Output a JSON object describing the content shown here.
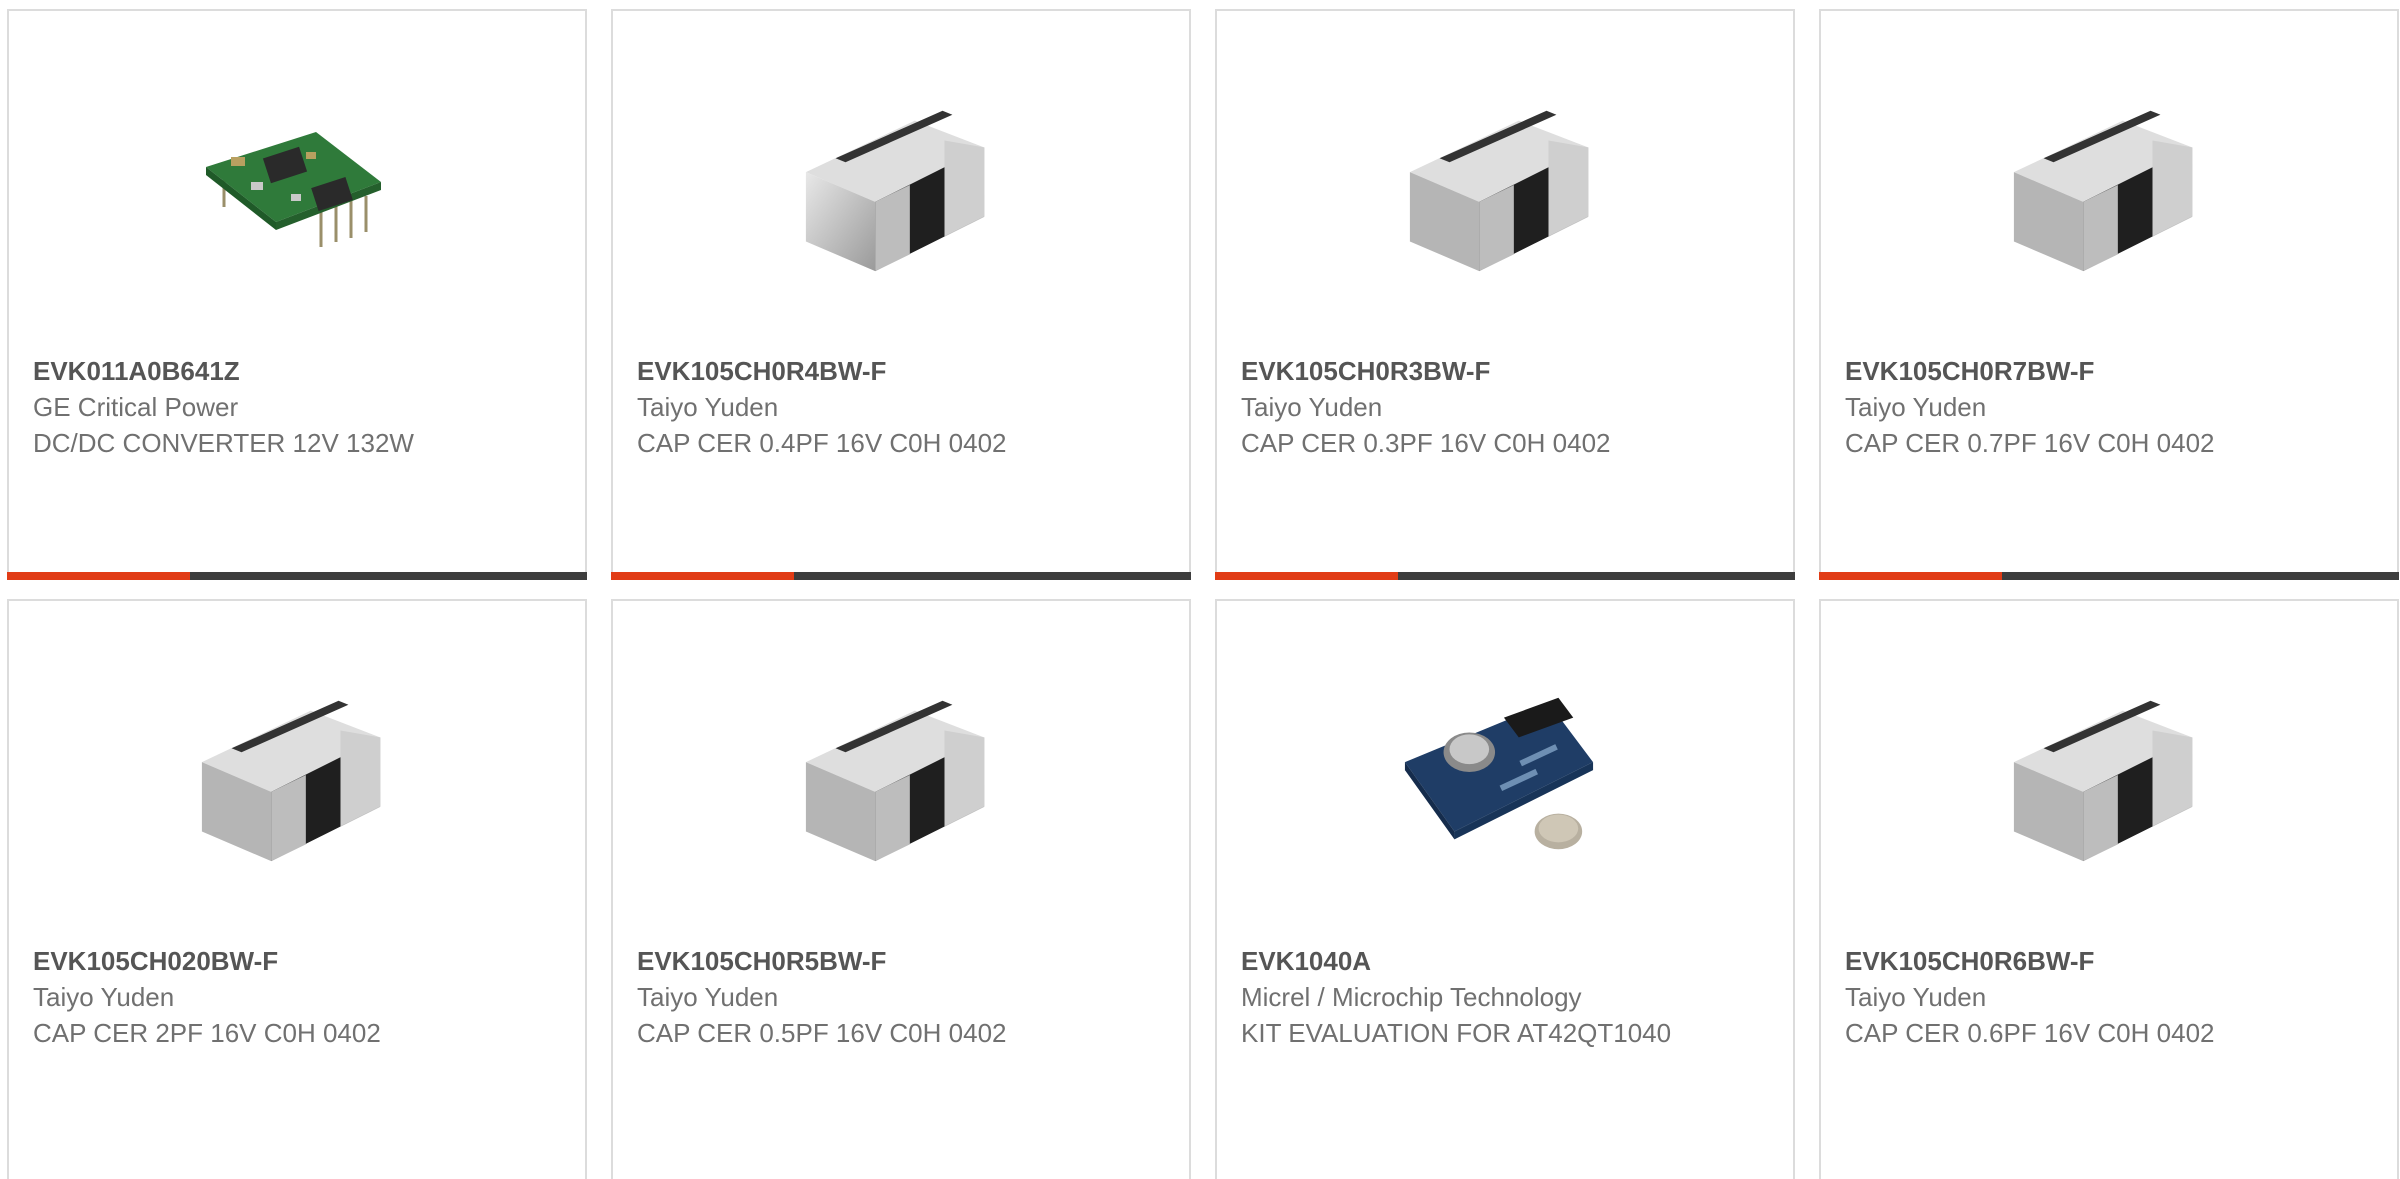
{
  "products": [
    {
      "part_number": "EVK011A0B641Z",
      "manufacturer": "GE Critical Power",
      "description": "DC/DC CONVERTER 12V 132W",
      "image": "dc-dc-module-image"
    },
    {
      "part_number": "EVK105CH0R4BW-F",
      "manufacturer": "Taiyo Yuden",
      "description": "CAP CER 0.4PF 16V C0H 0402",
      "image": "ceramic-capacitor-image"
    },
    {
      "part_number": "EVK105CH0R3BW-F",
      "manufacturer": "Taiyo Yuden",
      "description": "CAP CER 0.3PF 16V C0H 0402",
      "image": "ceramic-capacitor-image"
    },
    {
      "part_number": "EVK105CH0R7BW-F",
      "manufacturer": "Taiyo Yuden",
      "description": "CAP CER 0.7PF 16V C0H 0402",
      "image": "ceramic-capacitor-image"
    },
    {
      "part_number": "EVK105CH020BW-F",
      "manufacturer": "Taiyo Yuden",
      "description": "CAP CER 2PF 16V C0H 0402",
      "image": "ceramic-capacitor-image"
    },
    {
      "part_number": "EVK105CH0R5BW-F",
      "manufacturer": "Taiyo Yuden",
      "description": "CAP CER 0.5PF 16V C0H 0402",
      "image": "ceramic-capacitor-image"
    },
    {
      "part_number": "EVK1040A",
      "manufacturer": "Micrel / Microchip Technology",
      "description": "KIT EVALUATION FOR AT42QT1040",
      "image": "evaluation-board-image"
    },
    {
      "part_number": "EVK105CH0R6BW-F",
      "manufacturer": "Taiyo Yuden",
      "description": "CAP CER 0.6PF 16V C0H 0402",
      "image": "ceramic-capacitor-image"
    }
  ],
  "colors": {
    "accent": "#e13c16",
    "bar_dark": "#3d3d3d",
    "border": "#dcdcdc",
    "part_number_text": "#555555",
    "secondary_text": "#707070"
  }
}
